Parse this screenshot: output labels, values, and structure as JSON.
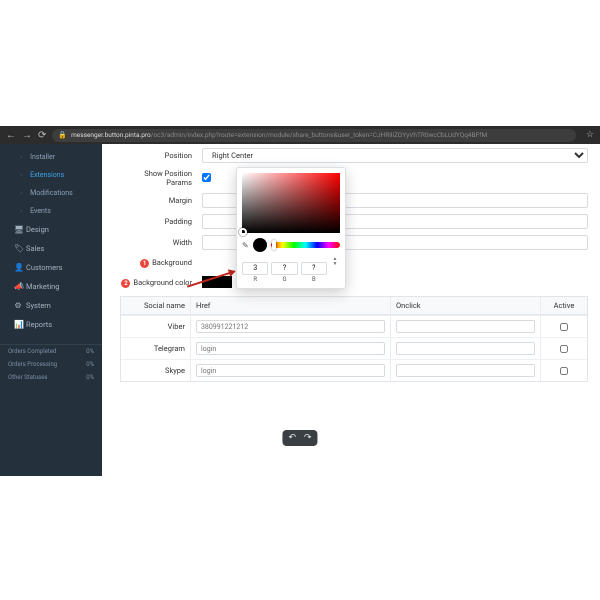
{
  "browser": {
    "host": "messenger.button.pinta.pro",
    "path": "/oc3/admin/index.php?route=extension/module/share_buttons&user_token=CJHRiIiZGYyVhTR0wcCbLUdYQq4BFfM"
  },
  "sidebar": {
    "installer": "Installer",
    "extensions": "Extensions",
    "modifications": "Modifications",
    "events": "Events",
    "design": "Design",
    "sales": "Sales",
    "customers": "Customers",
    "marketing": "Marketing",
    "system": "System",
    "reports": "Reports",
    "stats": [
      {
        "label": "Orders Completed",
        "value": "0%"
      },
      {
        "label": "Orders Processing",
        "value": "0%"
      },
      {
        "label": "Other Statuses",
        "value": "0%"
      }
    ]
  },
  "form": {
    "position_label": "Position",
    "position_value": "Right Center",
    "show_position_params_label": "Show Position Params",
    "margin_label": "Margin",
    "padding_label": "Padding",
    "width_label": "Width",
    "background_label": "Background",
    "background_color_label": "Background color",
    "badge1": "1",
    "badge2": "2"
  },
  "picker": {
    "r": "3",
    "g": "?",
    "b": "?",
    "lab_r": "R",
    "lab_g": "G",
    "lab_b": "B"
  },
  "table": {
    "head": {
      "name": "Social name",
      "href": "Href",
      "onclick": "Onclick",
      "active": "Active"
    },
    "rows": [
      {
        "name": "Viber",
        "href": "380991221212",
        "onclick": "",
        "active": false
      },
      {
        "name": "Telegram",
        "href": "login",
        "onclick": "",
        "active": false
      },
      {
        "name": "Skype",
        "href": "login",
        "onclick": "",
        "active": false
      }
    ]
  }
}
